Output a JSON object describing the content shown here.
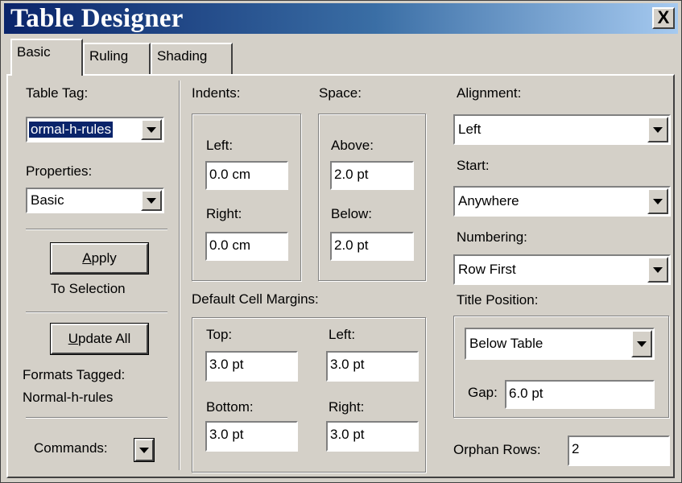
{
  "window": {
    "title": "Table Designer",
    "close_label": "X"
  },
  "tabs": [
    {
      "label": "Basic"
    },
    {
      "label": "Ruling"
    },
    {
      "label": "Shading"
    }
  ],
  "left": {
    "table_tag_label": "Table Tag:",
    "table_tag_value": "ormal-h-rules",
    "properties_label": "Properties:",
    "properties_value": "Basic",
    "apply_label_prefix": "",
    "apply_label_u": "A",
    "apply_label_rest": "pply",
    "to_selection": "To Selection",
    "update_label_u": "U",
    "update_label_rest": "pdate All",
    "formats_tagged_label": "Formats Tagged:",
    "formats_tagged_value": "Normal-h-rules",
    "commands_label": "Commands:"
  },
  "indents": {
    "label": "Indents:",
    "left_label": "Left:",
    "left_value": "0.0 cm",
    "right_label": "Right:",
    "right_value": "0.0 cm"
  },
  "space": {
    "label": "Space:",
    "above_label": "Above:",
    "above_value": "2.0 pt",
    "below_label": "Below:",
    "below_value": "2.0 pt"
  },
  "margins": {
    "label": "Default Cell Margins:",
    "top_label": "Top:",
    "top_value": "3.0 pt",
    "left_label": "Left:",
    "left_value": "3.0 pt",
    "bottom_label": "Bottom:",
    "bottom_value": "3.0 pt",
    "right_label": "Right:",
    "right_value": "3.0 pt"
  },
  "right": {
    "alignment_label": "Alignment:",
    "alignment_value": "Left",
    "start_label": "Start:",
    "start_value": "Anywhere",
    "numbering_label": "Numbering:",
    "numbering_value": "Row First",
    "title_position_label": "Title Position:",
    "title_position_value": "Below Table",
    "gap_label": "Gap:",
    "gap_value": "6.0 pt",
    "orphan_rows_label": "Orphan Rows:",
    "orphan_rows_value": "2"
  }
}
